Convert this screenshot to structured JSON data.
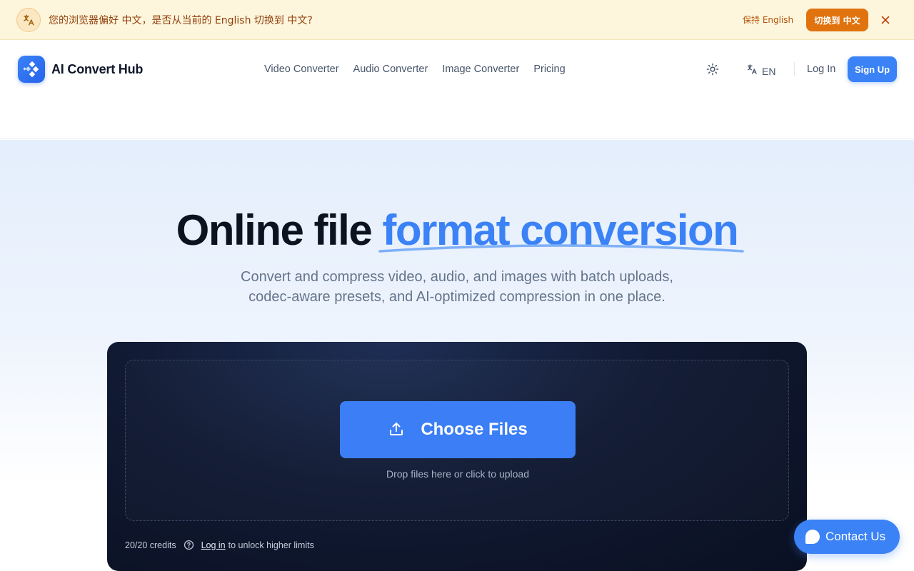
{
  "banner": {
    "icon": "translate-icon",
    "message": "您的浏览器偏好 中文，是否从当前的 English 切换到 中文?",
    "keep_label": "保持 English",
    "switch_label": "切换到 中文",
    "close_icon": "close-icon"
  },
  "header": {
    "brand": "AI Convert Hub",
    "nav": [
      "Video Converter",
      "Audio Converter",
      "Image Converter",
      "Pricing"
    ],
    "language": "EN",
    "login_label": "Log In",
    "signup_label": "Sign Up"
  },
  "hero": {
    "title_plain": "Online file",
    "title_accent": "format conversion",
    "subtitle_line1": "Convert and compress video, audio, and images with batch uploads,",
    "subtitle_line2": "codec-aware presets, and AI-optimized compression in one place."
  },
  "upload": {
    "choose_label": "Choose Files",
    "drop_hint": "Drop files here or click to upload",
    "credits": "20/20 credits",
    "login_link": "Log in",
    "unlock_text": "to unlock higher limits"
  },
  "contact": {
    "label": "Contact Us"
  },
  "colors": {
    "accent": "#3b82f6",
    "banner_bg": "#fdf6dc",
    "switch_btn": "#e0730e",
    "card_bg": "#111a33"
  }
}
